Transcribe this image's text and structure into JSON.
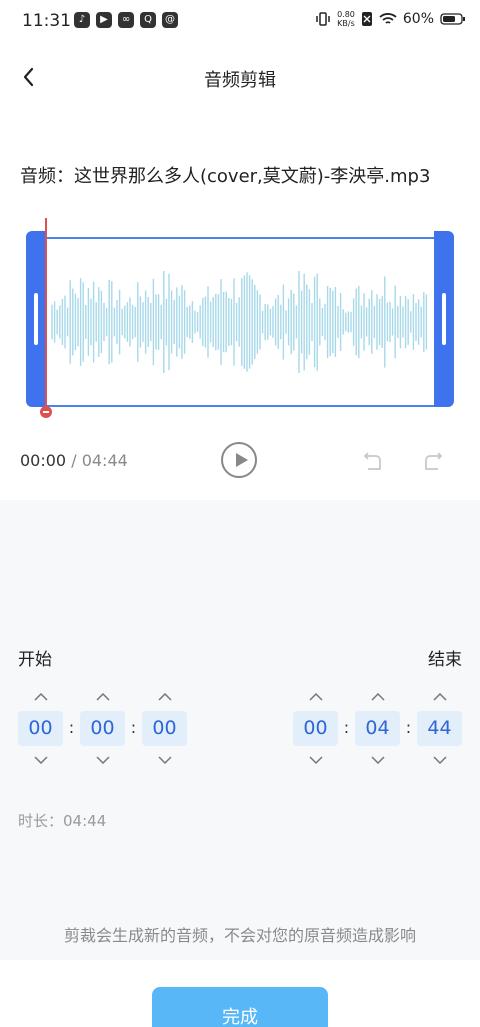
{
  "status_bar": {
    "time": "11:31",
    "net_speed_value": "0.80",
    "net_speed_unit": "KB/s",
    "battery": "60%"
  },
  "header": {
    "title": "音频剪辑"
  },
  "file": {
    "label": "音频：",
    "name": "这世界那么多人(cover,莫文蔚)-李泱亭.mp3"
  },
  "player": {
    "current_time": "00:00",
    "separator": "/",
    "total_time": "04:44",
    "playhead_position": 0.0
  },
  "trim": {
    "start_label": "开始",
    "end_label": "结束",
    "start": {
      "hours": "00",
      "minutes": "00",
      "seconds": "00"
    },
    "end": {
      "hours": "00",
      "minutes": "04",
      "seconds": "44"
    },
    "colon": ":",
    "duration_label": "时长：",
    "duration_value": "04:44"
  },
  "notice": "剪裁会生成新的音频，不会对您的原音频造成影响",
  "done_button": "完成",
  "colors": {
    "accent": "#3f73ee",
    "wave": "#a7d9ea",
    "playhead": "#e05050",
    "done": "#58b8f7",
    "time_box_bg": "#e3eefb",
    "time_box_text": "#2f66d6"
  }
}
